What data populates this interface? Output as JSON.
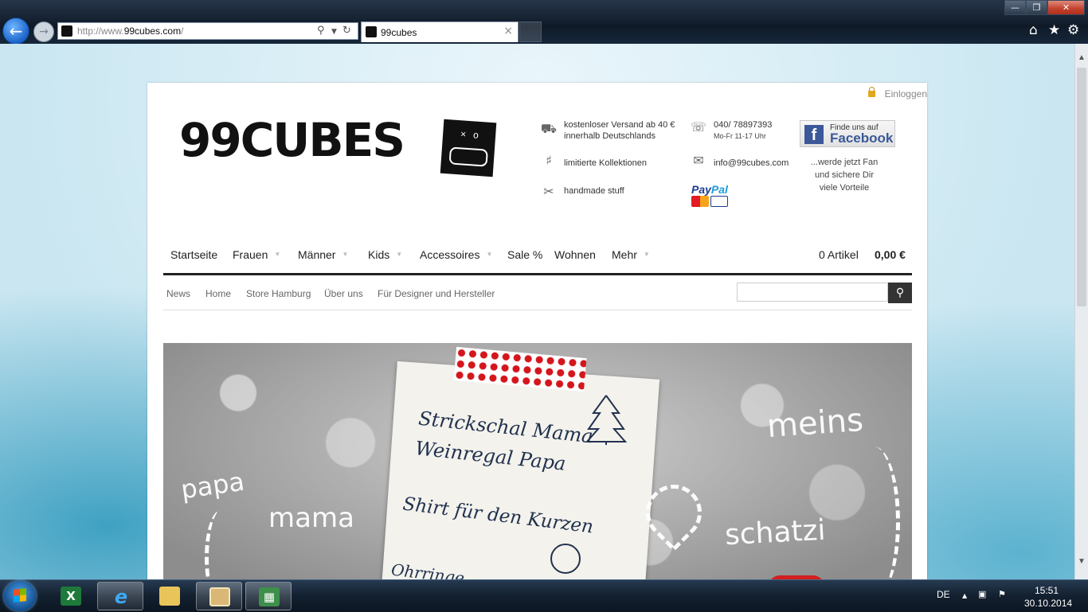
{
  "browser": {
    "address_prefix": "http://www.",
    "address_domain": "99cubes.com",
    "address_suffix": "/",
    "tab_title": "99cubes",
    "tab_close": "×",
    "back_icon": "arrow-left-icon",
    "forward_icon": "arrow-right-icon"
  },
  "header": {
    "login": "Einloggen",
    "logo_text": "99CUBES",
    "info": {
      "shipping_line1": "kostenloser Versand ab 40 €",
      "shipping_line2": "innerhalb Deutschlands",
      "limited": "limitierte Kollektionen",
      "handmade": "handmade stuff",
      "phone": "040/ 78897393",
      "hours": "Mo-Fr 11-17 Uhr",
      "email": "info@99cubes.com",
      "paypal_pay": "Pay",
      "paypal_pal": "Pal"
    },
    "facebook": {
      "find_label": "Finde uns auf",
      "brand": "Facebook",
      "text_line1": "...werde jetzt Fan",
      "text_line2": "und sichere Dir",
      "text_line3": "viele Vorteile"
    }
  },
  "mainnav": {
    "items": [
      "Startseite",
      "Frauen",
      "Männer",
      "Kids",
      "Accessoires",
      "Sale %",
      "Wohnen",
      "Mehr"
    ],
    "cart_count": "0 Artikel",
    "cart_total": "0,00 €"
  },
  "subnav": {
    "items": [
      "News",
      "Home",
      "Store Hamburg",
      "Über uns",
      "Für Designer und Hersteller"
    ],
    "search_value": ""
  },
  "hero": {
    "note_line1": "Strickschal Mama",
    "note_line2": "Weinregal Papa",
    "note_line3": "Shirt für den Kurzen",
    "note_line4": "Ohrringe",
    "word_papa": "papa",
    "word_mama": "mama",
    "word_meins": "meins",
    "word_schatzi": "schatzi"
  },
  "taskbar": {
    "language": "DE",
    "time": "15:51",
    "date": "30.10.2014",
    "apps": [
      "excel-icon",
      "internet-explorer-icon",
      "file-explorer-icon",
      "photo-viewer-icon",
      "spreadsheet-icon"
    ]
  },
  "colors": {
    "accent_red": "#d4161c",
    "facebook_blue": "#3b5998",
    "paypal_blue": "#1a3d8f"
  }
}
